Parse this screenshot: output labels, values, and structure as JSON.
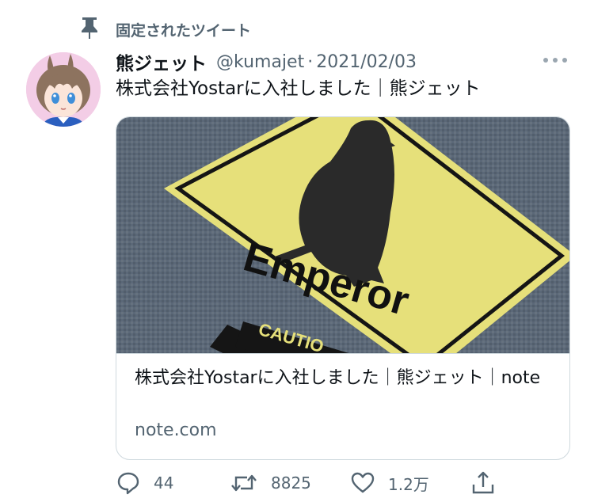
{
  "pinned": {
    "label": "固定されたツイート",
    "icon": "pin-icon"
  },
  "tweet": {
    "display_name": "熊ジェット",
    "handle": "@kumajet",
    "separator": "·",
    "date": "2021/02/03",
    "text": "株式会社Yostarに入社しました｜熊ジェット",
    "more_icon": "more-icon"
  },
  "card": {
    "image": {
      "sign_text": "Emperor",
      "caution_text": "CAUTIO"
    },
    "title": "株式会社Yostarに入社しました｜熊ジェット｜note",
    "domain": "note.com"
  },
  "actions": {
    "reply_count": "44",
    "retweet_count": "8825",
    "like_count": "1.2万"
  },
  "colors": {
    "secondary_text": "#536471",
    "border": "#cfd9de",
    "sign_yellow": "#e8e27a",
    "background_grey": "#596676"
  }
}
